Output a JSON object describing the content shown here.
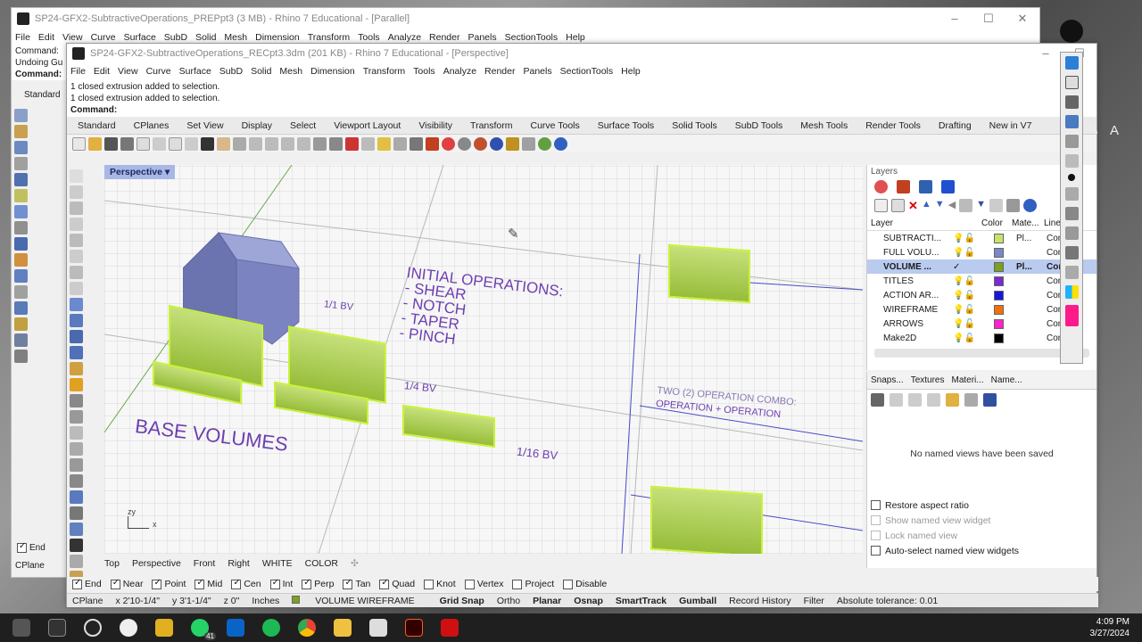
{
  "back_window": {
    "title": "SP24-GFX2-SubtractiveOperations_PREPpt3 (3 MB) - Rhino 7 Educational - [Parallel]",
    "menu": [
      "File",
      "Edit",
      "View",
      "Curve",
      "Surface",
      "SubD",
      "Solid",
      "Mesh",
      "Dimension",
      "Transform",
      "Tools",
      "Analyze",
      "Render",
      "Panels",
      "SectionTools",
      "Help"
    ],
    "cmd_lines": [
      "Command:",
      "Undoing Gu",
      "Command:"
    ],
    "standard_label": "Standard",
    "end_label": "End",
    "cplane_label": "CPlane"
  },
  "front_window": {
    "title": "SP24-GFX2-SubtractiveOperations_RECpt3.3dm (201 KB) - Rhino 7 Educational - [Perspective]",
    "menu": [
      "File",
      "Edit",
      "View",
      "Curve",
      "Surface",
      "SubD",
      "Solid",
      "Mesh",
      "Dimension",
      "Transform",
      "Tools",
      "Analyze",
      "Render",
      "Panels",
      "SectionTools",
      "Help"
    ],
    "history": [
      "1 closed extrusion added to selection.",
      "1 closed extrusion added to selection."
    ],
    "command_label": "Command:",
    "toolbar_tabs": [
      "Standard",
      "CPlanes",
      "Set View",
      "Display",
      "Select",
      "Viewport Layout",
      "Visibility",
      "Transform",
      "Curve Tools",
      "Surface Tools",
      "Solid Tools",
      "SubD Tools",
      "Mesh Tools",
      "Render Tools",
      "Drafting",
      "New in V7"
    ]
  },
  "viewport": {
    "label": "Perspective",
    "text_initial": [
      "INITIAL OPERATIONS:",
      "- SHEAR",
      "- NOTCH",
      "- TAPER",
      "- PINCH"
    ],
    "text_base": "BASE VOLUMES",
    "text_1_1": "1/1 BV",
    "text_1_4": "1/4 BV",
    "text_1_16": "1/16 BV",
    "text_combo": [
      "TWO (2) OPERATION COMBO:",
      "OPERATION + OPERATION"
    ],
    "axis_x": "x",
    "axis_y": "y",
    "axis_z": "z"
  },
  "view_tabs": [
    "Top",
    "Perspective",
    "Front",
    "Right",
    "WHITE",
    "COLOR"
  ],
  "osnaps": [
    {
      "label": "End",
      "on": true
    },
    {
      "label": "Near",
      "on": true
    },
    {
      "label": "Point",
      "on": true
    },
    {
      "label": "Mid",
      "on": true
    },
    {
      "label": "Cen",
      "on": true
    },
    {
      "label": "Int",
      "on": true
    },
    {
      "label": "Perp",
      "on": true
    },
    {
      "label": "Tan",
      "on": true
    },
    {
      "label": "Quad",
      "on": true
    },
    {
      "label": "Knot",
      "on": false
    },
    {
      "label": "Vertex",
      "on": false
    },
    {
      "label": "Project",
      "on": false
    },
    {
      "label": "Disable",
      "on": false
    }
  ],
  "status": {
    "cplane": "CPlane",
    "x": "x 2'10-1/4\"",
    "y": "y 3'1-1/4\"",
    "z": "z 0\"",
    "units": "Inches",
    "layer": "VOLUME WIREFRAME",
    "grid_snap": "Grid Snap",
    "ortho": "Ortho",
    "planar": "Planar",
    "osnap": "Osnap",
    "smarttrack": "SmartTrack",
    "gumball": "Gumball",
    "record_history": "Record History",
    "filter": "Filter",
    "tolerance": "Absolute tolerance: 0.01"
  },
  "layers_panel": {
    "title": "Layers",
    "col_layer": "Layer",
    "col_color": "Color",
    "col_material": "Mate...",
    "col_linetype": "Line",
    "rows": [
      {
        "name": "SUBTRACTI...",
        "color": "#c9e26a",
        "mat": "Pl...",
        "lt": "Con"
      },
      {
        "name": "FULL VOLU...",
        "color": "#7b86c4",
        "mat": "",
        "lt": "Con"
      },
      {
        "name": "VOLUME ...",
        "color": "#7aa11f",
        "mat": "Pl...",
        "lt": "Con"
      },
      {
        "name": "TITLES",
        "color": "#7a2ad0",
        "mat": "",
        "lt": "Con"
      },
      {
        "name": "ACTION AR...",
        "color": "#1515e0",
        "mat": "",
        "lt": "Con"
      },
      {
        "name": "WIREFRAME",
        "color": "#f07010",
        "mat": "",
        "lt": "Con"
      },
      {
        "name": "ARROWS",
        "color": "#ff22cc",
        "mat": "",
        "lt": "Con"
      },
      {
        "name": "Make2D",
        "color": "#000000",
        "mat": "",
        "lt": "Con"
      }
    ]
  },
  "views_panel": {
    "tabs": [
      "Snaps...",
      "Textures",
      "Materi...",
      "Name..."
    ],
    "empty_msg": "No named views have been saved",
    "options": [
      {
        "label": "Restore aspect ratio",
        "dim": false
      },
      {
        "label": "Show named view widget",
        "dim": true
      },
      {
        "label": "Lock named view",
        "dim": true
      },
      {
        "label": "Auto-select named view widgets",
        "dim": false
      }
    ]
  },
  "clock": {
    "time": "4:09 PM",
    "date": "3/27/2024"
  },
  "taskbar_badge": "41"
}
